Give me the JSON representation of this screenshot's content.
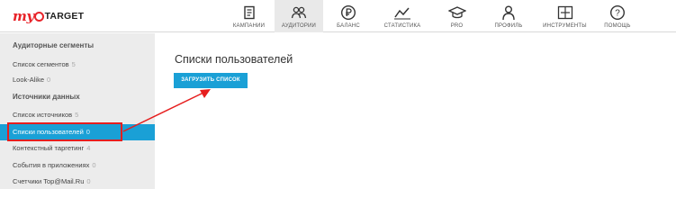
{
  "brand": {
    "my": "my",
    "target": "TARGET"
  },
  "nav": [
    {
      "label": "КАМПАНИИ",
      "icon": "campaigns-icon"
    },
    {
      "label": "АУДИТОРИИ",
      "icon": "audiences-icon"
    },
    {
      "label": "БАЛАНС",
      "icon": "ruble-icon"
    },
    {
      "label": "СТАТИСТИКА",
      "icon": "statistics-icon"
    },
    {
      "label": "PRO",
      "icon": "graduation-cap-icon"
    },
    {
      "label": "ПРОФИЛЬ",
      "icon": "profile-icon"
    },
    {
      "label": "ИНСТРУМЕНТЫ",
      "icon": "tools-icon"
    },
    {
      "label": "ПОМОЩЬ",
      "icon": "help-icon"
    }
  ],
  "sidebar": {
    "sections": [
      {
        "title": "Аудиторные сегменты"
      },
      {
        "title": "Источники данных"
      }
    ],
    "items": [
      {
        "label": "Список сегментов",
        "count": "5"
      },
      {
        "label": "Look-Alike",
        "count": "0"
      },
      {
        "label": "Список источников",
        "count": "5"
      },
      {
        "label": "Списки пользователей",
        "count": "0"
      },
      {
        "label": "Контекстный таргетинг",
        "count": "4"
      },
      {
        "label": "События в приложениях",
        "count": "0"
      },
      {
        "label": "Счетчики Top@Mail.Ru",
        "count": "0"
      }
    ]
  },
  "main": {
    "title": "Списки пользователей",
    "upload_button": "ЗАГРУЗИТЬ СПИСОК"
  },
  "colors": {
    "accent": "#1aa0d6",
    "brand_red": "#e8242a",
    "annotation_red": "#e61e1e"
  }
}
